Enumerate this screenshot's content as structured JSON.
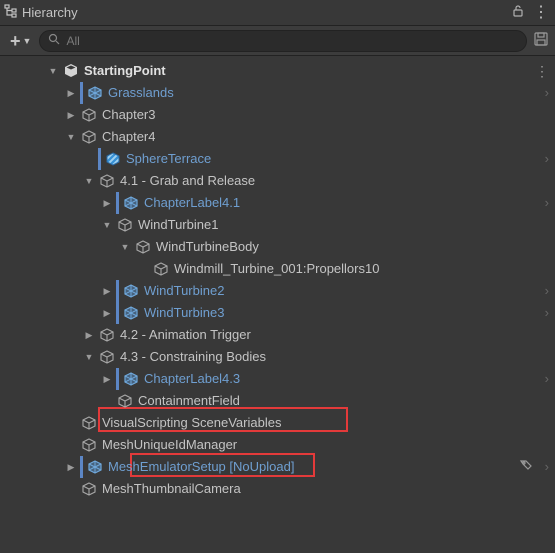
{
  "panel": {
    "title": "Hierarchy"
  },
  "search": {
    "placeholder": "All"
  },
  "rows": [
    {
      "label": "StartingPoint",
      "depth": 0,
      "expander": "down",
      "icon": "scene",
      "link": false,
      "bold": true,
      "chevron": false,
      "kebab": true,
      "vbar": false
    },
    {
      "label": "Grasslands",
      "depth": 1,
      "expander": "right",
      "icon": "prefab",
      "link": true,
      "bold": false,
      "chevron": true,
      "kebab": false,
      "vbar": true
    },
    {
      "label": "Chapter3",
      "depth": 1,
      "expander": "right",
      "icon": "cube",
      "link": false,
      "bold": false,
      "chevron": false,
      "kebab": false,
      "vbar": false
    },
    {
      "label": "Chapter4",
      "depth": 1,
      "expander": "down",
      "icon": "cube",
      "link": false,
      "bold": false,
      "chevron": false,
      "kebab": false,
      "vbar": false
    },
    {
      "label": "SphereTerrace",
      "depth": 2,
      "expander": "none",
      "icon": "stripe",
      "link": true,
      "bold": false,
      "chevron": true,
      "kebab": false,
      "vbar": true
    },
    {
      "label": "4.1 - Grab and Release",
      "depth": 2,
      "expander": "down",
      "icon": "cube",
      "link": false,
      "bold": false,
      "chevron": false,
      "kebab": false,
      "vbar": false
    },
    {
      "label": "ChapterLabel4.1",
      "depth": 3,
      "expander": "right",
      "icon": "prefab",
      "link": true,
      "bold": false,
      "chevron": true,
      "kebab": false,
      "vbar": true
    },
    {
      "label": "WindTurbine1",
      "depth": 3,
      "expander": "down",
      "icon": "cube",
      "link": false,
      "bold": false,
      "chevron": false,
      "kebab": false,
      "vbar": false
    },
    {
      "label": "WindTurbineBody",
      "depth": 4,
      "expander": "down",
      "icon": "cube",
      "link": false,
      "bold": false,
      "chevron": false,
      "kebab": false,
      "vbar": false
    },
    {
      "label": "Windmill_Turbine_001:Propellors10",
      "depth": 5,
      "expander": "none",
      "icon": "cube",
      "link": false,
      "bold": false,
      "chevron": false,
      "kebab": false,
      "vbar": false
    },
    {
      "label": "WindTurbine2",
      "depth": 3,
      "expander": "right",
      "icon": "prefab",
      "link": true,
      "bold": false,
      "chevron": true,
      "kebab": false,
      "vbar": true
    },
    {
      "label": "WindTurbine3",
      "depth": 3,
      "expander": "right",
      "icon": "prefab",
      "link": true,
      "bold": false,
      "chevron": true,
      "kebab": false,
      "vbar": true
    },
    {
      "label": "4.2 - Animation Trigger",
      "depth": 2,
      "expander": "right",
      "icon": "cube",
      "link": false,
      "bold": false,
      "chevron": false,
      "kebab": false,
      "vbar": false
    },
    {
      "label": "4.3 - Constraining Bodies",
      "depth": 2,
      "expander": "down",
      "icon": "cube",
      "link": false,
      "bold": false,
      "chevron": false,
      "kebab": false,
      "vbar": false
    },
    {
      "label": "ChapterLabel4.3",
      "depth": 3,
      "expander": "right",
      "icon": "prefab",
      "link": true,
      "bold": false,
      "chevron": true,
      "kebab": false,
      "vbar": true
    },
    {
      "label": "ContainmentField",
      "depth": 3,
      "expander": "none",
      "icon": "cube",
      "link": false,
      "bold": false,
      "chevron": false,
      "kebab": false,
      "vbar": false
    },
    {
      "label": "VisualScripting SceneVariables",
      "depth": 1,
      "expander": "none",
      "icon": "cube",
      "link": false,
      "bold": false,
      "chevron": false,
      "kebab": false,
      "vbar": false
    },
    {
      "label": "MeshUniqueIdManager",
      "depth": 1,
      "expander": "none",
      "icon": "cube",
      "link": false,
      "bold": false,
      "chevron": false,
      "kebab": false,
      "vbar": false
    },
    {
      "label": "MeshEmulatorSetup [NoUpload]",
      "depth": 1,
      "expander": "right",
      "icon": "prefab",
      "link": true,
      "bold": false,
      "chevron": true,
      "kebab": false,
      "vbar": true,
      "tag": true
    },
    {
      "label": "MeshThumbnailCamera",
      "depth": 1,
      "expander": "none",
      "icon": "cube",
      "link": false,
      "bold": false,
      "chevron": false,
      "kebab": false,
      "vbar": false
    }
  ]
}
